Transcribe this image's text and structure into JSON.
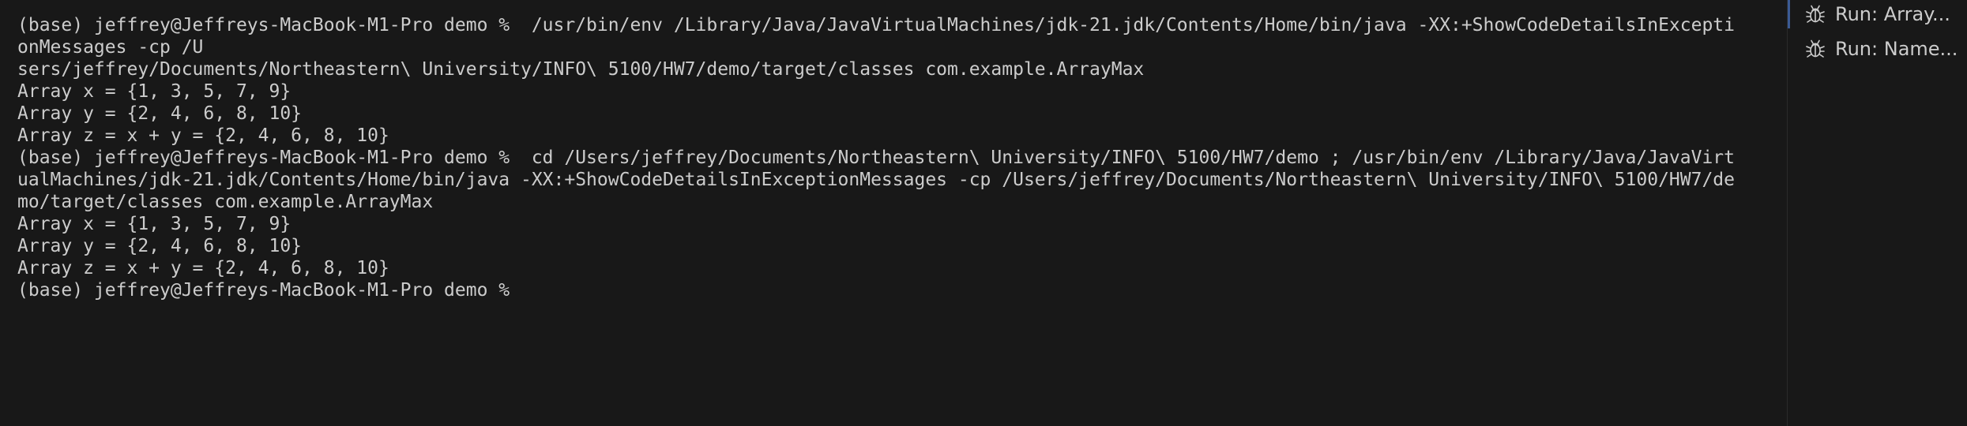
{
  "terminal": {
    "lines": [
      "(base) jeffrey@Jeffreys-MacBook-M1-Pro demo %  /usr/bin/env /Library/Java/JavaVirtualMachines/jdk-21.jdk/Contents/Home/bin/java -XX:+ShowCodeDetailsInExcepti",
      "onMessages -cp /U",
      "sers/jeffrey/Documents/Northeastern\\ University/INFO\\ 5100/HW7/demo/target/classes com.example.ArrayMax",
      "Array x = {1, 3, 5, 7, 9}",
      "Array y = {2, 4, 6, 8, 10}",
      "Array z = x + y = {2, 4, 6, 8, 10}",
      "(base) jeffrey@Jeffreys-MacBook-M1-Pro demo %  cd /Users/jeffrey/Documents/Northeastern\\ University/INFO\\ 5100/HW7/demo ; /usr/bin/env /Library/Java/JavaVirt",
      "ualMachines/jdk-21.jdk/Contents/Home/bin/java -XX:+ShowCodeDetailsInExceptionMessages -cp /Users/jeffrey/Documents/Northeastern\\ University/INFO\\ 5100/HW7/de",
      "mo/target/classes com.example.ArrayMax",
      "Array x = {1, 3, 5, 7, 9}",
      "Array y = {2, 4, 6, 8, 10}",
      "Array z = x + y = {2, 4, 6, 8, 10}"
    ],
    "prompt": "(base) jeffrey@Jeffreys-MacBook-M1-Pro demo %"
  },
  "sessions": [
    {
      "label": "Run: Array...",
      "icon": "bug-icon",
      "active": true
    },
    {
      "label": "Run: Name...",
      "icon": "bug-icon",
      "active": false
    }
  ],
  "colors": {
    "background": "#181818",
    "text": "#cccccc",
    "active_accent": "#3b5a94"
  }
}
